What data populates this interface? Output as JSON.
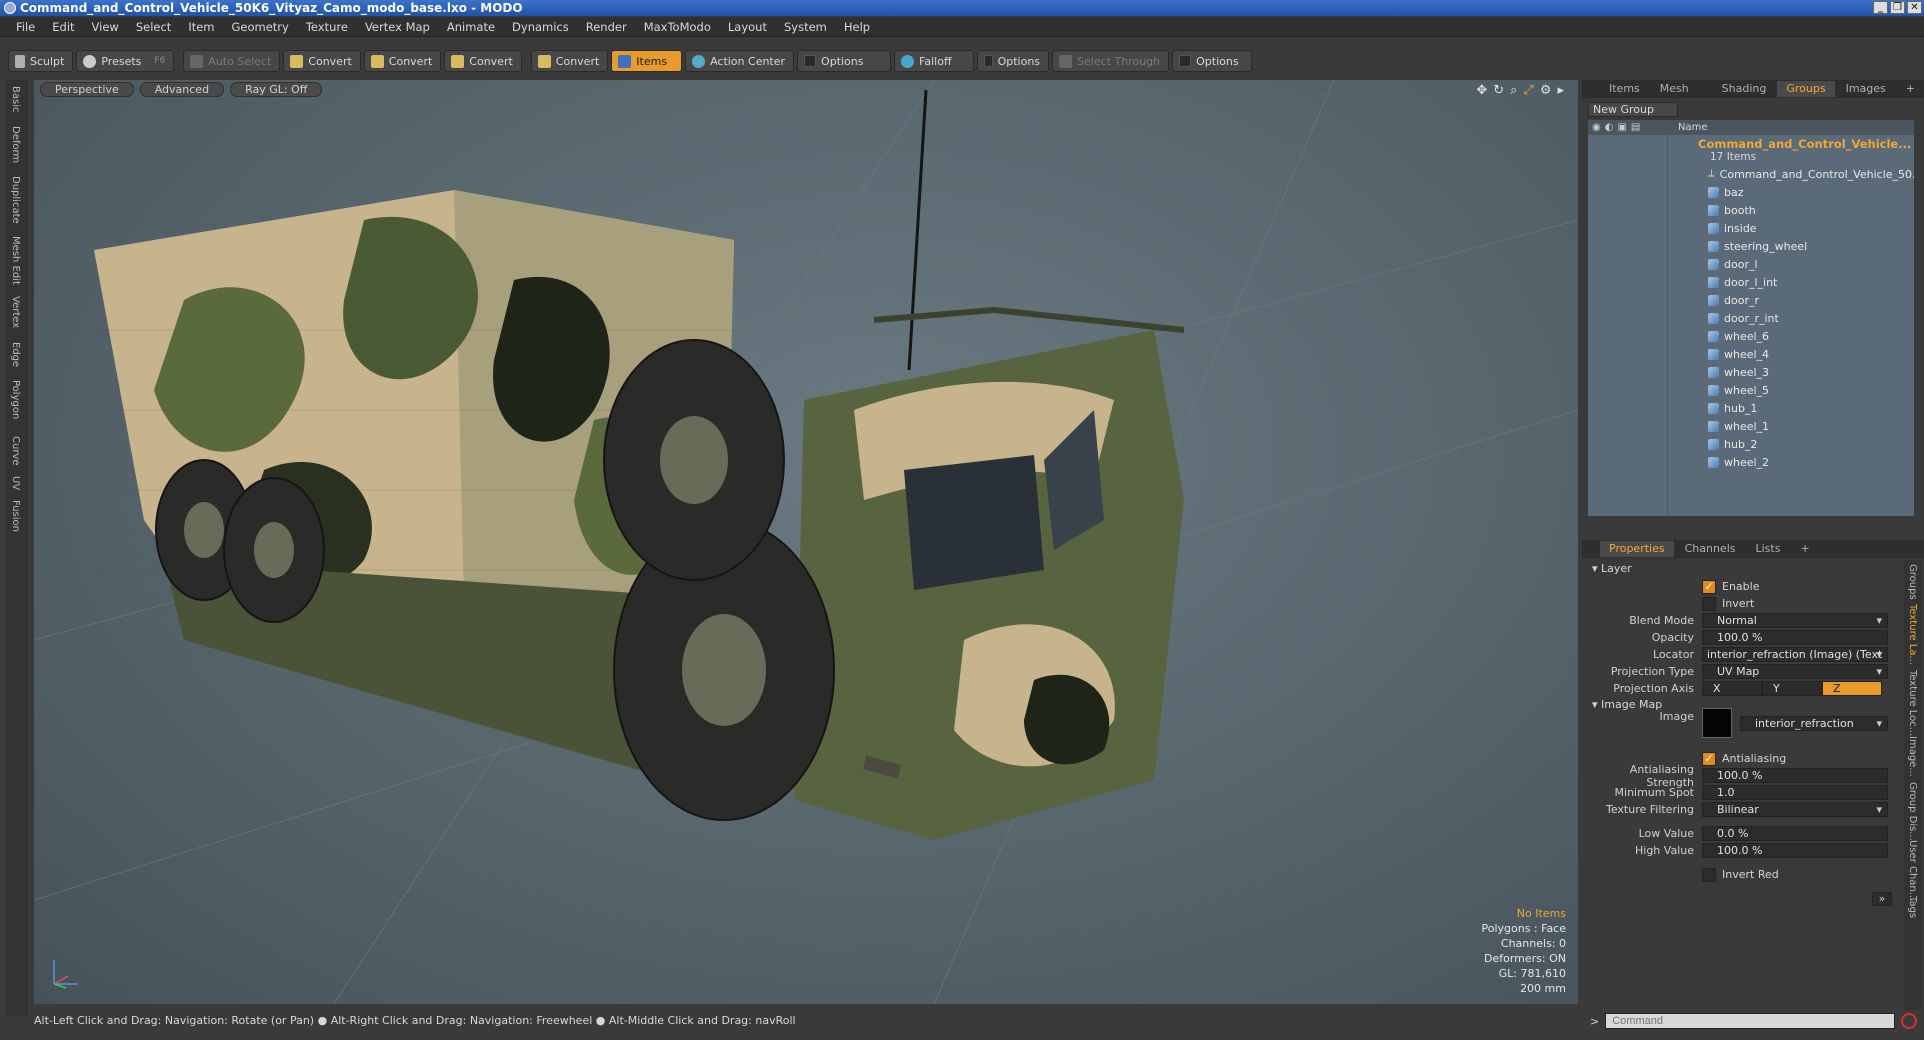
{
  "window": {
    "title": "Command_and_Control_Vehicle_50K6_Vityaz_Camo_modo_base.lxo - MODO"
  },
  "menu": [
    "File",
    "Edit",
    "View",
    "Select",
    "Item",
    "Geometry",
    "Texture",
    "Vertex Map",
    "Animate",
    "Dynamics",
    "Render",
    "MaxToModo",
    "Layout",
    "System",
    "Help"
  ],
  "toolbar": {
    "sculpt": "Sculpt",
    "presets": "Presets",
    "presets_key": "F6",
    "auto_select": "Auto Select",
    "convert1": "Convert",
    "convert2": "Convert",
    "convert3": "Convert",
    "convert4": "Convert",
    "items": "Items",
    "action_center": "Action Center",
    "options1": "Options",
    "falloff": "Falloff",
    "options2": "Options",
    "select_through": "Select Through",
    "options3": "Options"
  },
  "left_tabs": [
    "Basic",
    "Deform",
    "Duplicate",
    "Mesh Edit",
    "Vertex",
    "Edge",
    "Polygon",
    "Curve",
    "UV",
    "Fusion"
  ],
  "viewport": {
    "view_mode": "Perspective",
    "advanced": "Advanced",
    "raygl": "Ray GL: Off",
    "info": {
      "no_items": "No Items",
      "polygons": "Polygons : Face",
      "channels": "Channels: 0",
      "deformers": "Deformers: ON",
      "gl": "GL: 781,610",
      "scale": "200 mm"
    }
  },
  "status_text": "Alt-Left Click and Drag: Navigation: Rotate (or Pan) ● Alt-Right Click and Drag: Navigation: Freewheel ● Alt-Middle Click and Drag: navRoll",
  "panel_tabs": [
    "Items",
    "Mesh ...",
    "Shading",
    "Groups",
    "Images"
  ],
  "groups": {
    "new_group": "New Group",
    "name_header": "Name",
    "group_name": "Command_and_Control_Vehicle...",
    "group_count": "17 Items",
    "items": [
      {
        "name": "Command_and_Control_Vehicle_50...",
        "icon": "locator-icon"
      },
      {
        "name": "baz",
        "icon": "mesh-icon"
      },
      {
        "name": "booth",
        "icon": "mesh-icon"
      },
      {
        "name": "inside",
        "icon": "mesh-icon"
      },
      {
        "name": "steering_wheel",
        "icon": "mesh-icon"
      },
      {
        "name": "door_l",
        "icon": "mesh-icon"
      },
      {
        "name": "door_l_int",
        "icon": "mesh-icon"
      },
      {
        "name": "door_r",
        "icon": "mesh-icon"
      },
      {
        "name": "door_r_int",
        "icon": "mesh-icon"
      },
      {
        "name": "wheel_6",
        "icon": "mesh-icon"
      },
      {
        "name": "wheel_4",
        "icon": "mesh-icon"
      },
      {
        "name": "wheel_3",
        "icon": "mesh-icon"
      },
      {
        "name": "wheel_5",
        "icon": "mesh-icon"
      },
      {
        "name": "hub_1",
        "icon": "mesh-icon"
      },
      {
        "name": "wheel_1",
        "icon": "mesh-icon"
      },
      {
        "name": "hub_2",
        "icon": "mesh-icon"
      },
      {
        "name": "wheel_2",
        "icon": "mesh-icon"
      }
    ]
  },
  "prop_tabs": [
    "Properties",
    "Channels",
    "Lists"
  ],
  "properties": {
    "layer": "Layer",
    "enable": "Enable",
    "invert": "Invert",
    "blend_mode_label": "Blend Mode",
    "blend_mode": "Normal",
    "opacity_label": "Opacity",
    "opacity": "100.0 %",
    "locator_label": "Locator",
    "locator": "interior_refraction (Image) (Text ...",
    "projection_type_label": "Projection Type",
    "projection_type": "UV Map",
    "projection_axis_label": "Projection Axis",
    "axis_x": "X",
    "axis_y": "Y",
    "axis_z": "Z",
    "image_map": "Image Map",
    "image_label": "Image",
    "image": "interior_refraction",
    "antialiasing": "Antialiasing",
    "aa_strength_label": "Antialiasing Strength",
    "aa_strength": "100.0 %",
    "min_spot_label": "Minimum Spot",
    "min_spot": "1.0",
    "tex_filter_label": "Texture Filtering",
    "tex_filter": "Bilinear",
    "low_value_label": "Low Value",
    "low_value": "0.0 %",
    "high_value_label": "High Value",
    "high_value": "100.0 %",
    "invert_red": "Invert Red"
  },
  "right_vtabs": [
    "Groups",
    "Texture La...",
    "Texture Loc...",
    "Image...",
    "Group Dis...",
    "User Chan...",
    "Tags"
  ],
  "command": {
    "placeholder": "Command"
  },
  "colors": {
    "accent": "#e89a2a",
    "tree_bg": "#5a6a78",
    "viewport_bg": "#5a6870"
  }
}
